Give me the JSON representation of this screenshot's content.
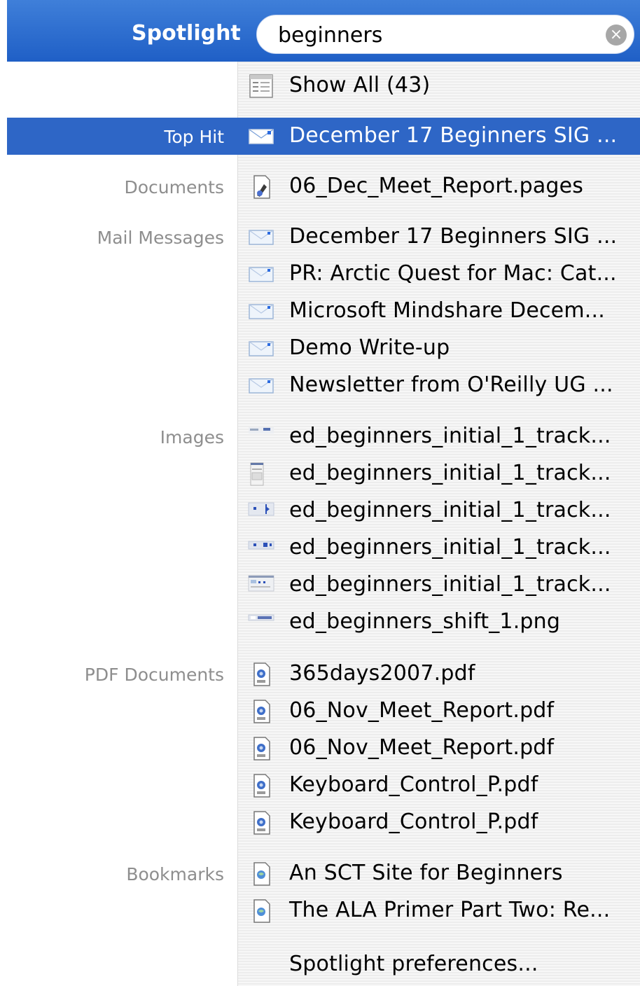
{
  "header": {
    "title": "Spotlight",
    "search_value": "beginners",
    "clear_label": "×"
  },
  "show_all": {
    "label": "Show All (43)"
  },
  "top_hit": {
    "category": "Top Hit",
    "title": "December 17 Beginners SIG ...",
    "icon": "mail-icon"
  },
  "documents": {
    "category": "Documents",
    "items": [
      {
        "title": "06_Dec_Meet_Report.pages",
        "icon": "pages-document-icon"
      }
    ]
  },
  "mail_messages": {
    "category": "Mail Messages",
    "items": [
      {
        "title": "December 17 Beginners SIG ...",
        "icon": "mail-icon"
      },
      {
        "title": "PR: Arctic Quest for Mac: Cat...",
        "icon": "mail-icon"
      },
      {
        "title": "Microsoft Mindshare Decem...",
        "icon": "mail-icon"
      },
      {
        "title": "Demo Write-up",
        "icon": "mail-icon"
      },
      {
        "title": "Newsletter from O'Reilly UG ...",
        "icon": "mail-icon"
      }
    ]
  },
  "images": {
    "category": "Images",
    "items": [
      {
        "title": "ed_beginners_initial_1_track...",
        "icon": "image-thumbnail-icon"
      },
      {
        "title": "ed_beginners_initial_1_track...",
        "icon": "image-thumbnail-icon"
      },
      {
        "title": "ed_beginners_initial_1_track...",
        "icon": "image-thumbnail-icon"
      },
      {
        "title": "ed_beginners_initial_1_track...",
        "icon": "image-thumbnail-icon"
      },
      {
        "title": "ed_beginners_initial_1_track...",
        "icon": "image-thumbnail-icon"
      },
      {
        "title": "ed_beginners_shift_1.png",
        "icon": "image-thumbnail-icon"
      }
    ]
  },
  "pdf_documents": {
    "category": "PDF Documents",
    "items": [
      {
        "title": "365days2007.pdf",
        "icon": "pdf-document-icon"
      },
      {
        "title": "06_Nov_Meet_Report.pdf",
        "icon": "pdf-document-icon"
      },
      {
        "title": "06_Nov_Meet_Report.pdf",
        "icon": "pdf-document-icon"
      },
      {
        "title": "Keyboard_Control_P.pdf",
        "icon": "pdf-document-icon"
      },
      {
        "title": "Keyboard_Control_P.pdf",
        "icon": "pdf-document-icon"
      }
    ]
  },
  "bookmarks": {
    "category": "Bookmarks",
    "items": [
      {
        "title": "An SCT Site for Beginners",
        "icon": "bookmark-icon"
      },
      {
        "title": "The ALA Primer Part Two: Re...",
        "icon": "bookmark-icon"
      }
    ]
  },
  "preferences": {
    "label": "Spotlight preferences..."
  },
  "colors": {
    "header_blue": "#2e66c6",
    "selection_blue": "#2e66c6",
    "category_gray": "#8e8e8e"
  }
}
